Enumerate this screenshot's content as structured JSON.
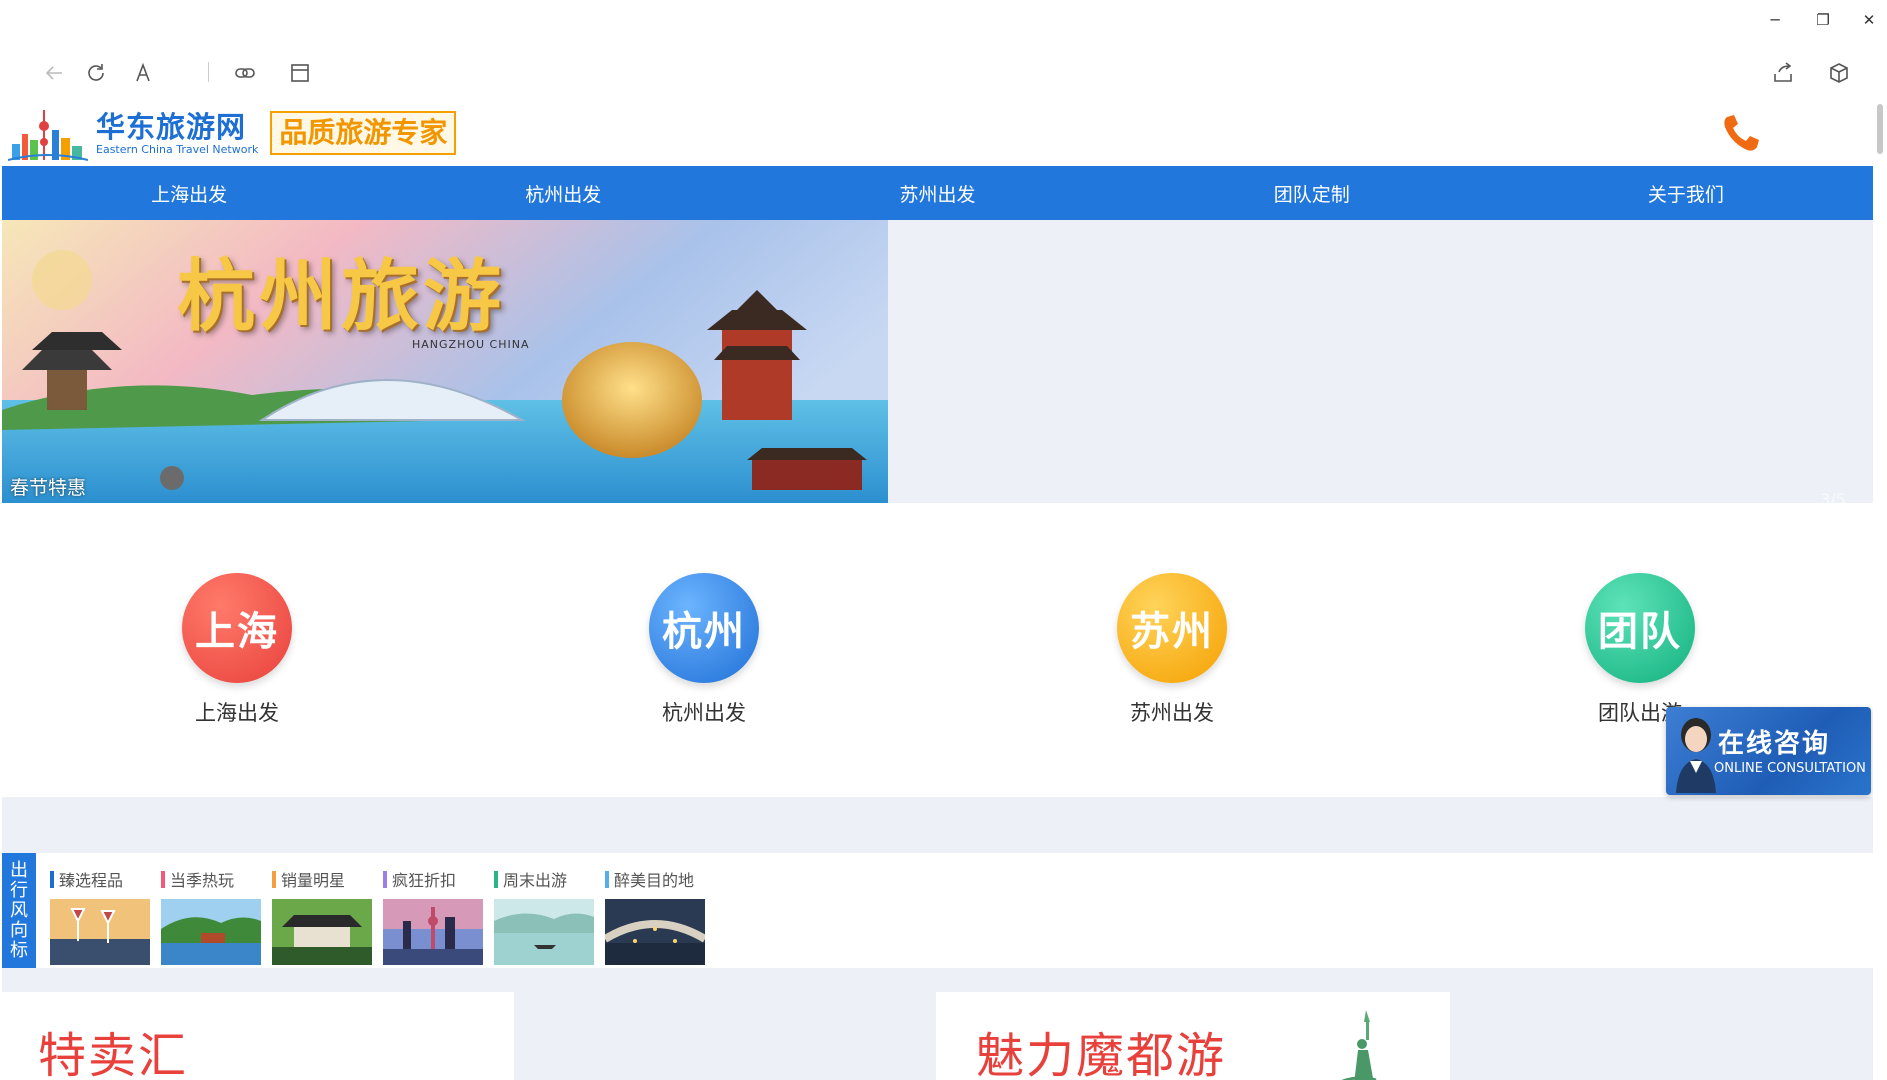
{
  "window": {
    "controls": [
      "─",
      "❐",
      "✕"
    ]
  },
  "toolbar": {
    "icons": [
      "back-arrow-icon",
      "refresh-icon",
      "font-icon",
      "link-icon",
      "layout-icon",
      "share-icon",
      "package-icon"
    ]
  },
  "header": {
    "logo_cn": "华东旅游网",
    "logo_en": "Eastern China Travel Network",
    "slogan": "品质旅游专家"
  },
  "nav": {
    "items": [
      "上海出发",
      "杭州出发",
      "苏州出发",
      "团队定制",
      "关于我们"
    ]
  },
  "banner": {
    "title": "杭州旅游",
    "subtitle": "HANGZHOU CHINA",
    "caption": "春节特惠",
    "counter": "3/5"
  },
  "departures": [
    {
      "icon_text": "上海",
      "label": "上海出发",
      "color": "#ef4c4c"
    },
    {
      "icon_text": "杭州",
      "label": "杭州出发",
      "color": "#2f86e6"
    },
    {
      "icon_text": "苏州",
      "label": "苏州出发",
      "color": "#f8b619"
    },
    {
      "icon_text": "团队",
      "label": "团队出游",
      "color": "#21c79a"
    }
  ],
  "consult": {
    "cn": "在线咨询",
    "en": "ONLINE CONSULTATION"
  },
  "guide": {
    "side_label": [
      "出",
      "行",
      "风",
      "向",
      "标"
    ],
    "items": [
      {
        "label": "臻选程品",
        "color": "#1a6fd0"
      },
      {
        "label": "当季热玩",
        "color": "#f25a7a"
      },
      {
        "label": "销量明星",
        "color": "#f2a03d"
      },
      {
        "label": "疯狂折扣",
        "color": "#9c7ee8"
      },
      {
        "label": "周末出游",
        "color": "#2bb58a"
      },
      {
        "label": "醉美目的地",
        "color": "#5aaee8"
      }
    ]
  },
  "sections": {
    "special": "特卖汇",
    "magic": "魅力魔都游"
  },
  "colors": {
    "nav_bg": "#2277dd",
    "accent_red": "#e8413c",
    "page_bg": "#edf1f7"
  }
}
